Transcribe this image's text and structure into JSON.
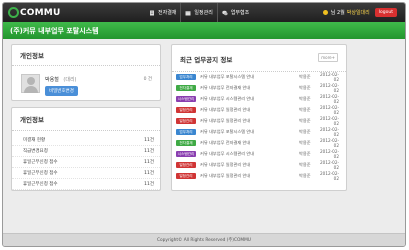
{
  "header": {
    "logo": "COMMU",
    "nav": [
      {
        "label": "전자결재",
        "icon": "document-icon"
      },
      {
        "label": "일정관리",
        "icon": "calendar-icon"
      },
      {
        "label": "업무협조",
        "icon": "chat-icon"
      }
    ],
    "user": {
      "prefix": "님 2월",
      "name": "박상일대리"
    },
    "logout_label": "logout"
  },
  "brand": {
    "title": "(주)커뮤 내부업무 포탈시스템"
  },
  "profile": {
    "title": "개인정보",
    "name": "박용철",
    "rank": "(대리)",
    "count": "0 건",
    "button": "비밀번호변경"
  },
  "personal_list": {
    "title": "개인정보",
    "rows": [
      {
        "label": "미결재 현황",
        "value": "11건"
      },
      {
        "label": "직급변경요청",
        "value": "11건"
      },
      {
        "label": "휴일근무신청 접수",
        "value": "11건"
      },
      {
        "label": "휴일근무신청 접수",
        "value": "11건"
      },
      {
        "label": "휴일근무신청 접수",
        "value": "11건"
      }
    ]
  },
  "notices": {
    "title": "최근 업무공지 정보",
    "more": "more+",
    "rows": [
      {
        "badge": "업무처리",
        "color": "#3a86d0",
        "title": "커뮤 내부업무 포탈시스템 안내",
        "author": "박용준",
        "date": "2012-02-02"
      },
      {
        "badge": "전자결재",
        "color": "#3faa45",
        "title": "커뮤 내부업무 전자결재 안내",
        "author": "박용준",
        "date": "2012-02-02"
      },
      {
        "badge": "시스템관리",
        "color": "#8a3fb0",
        "title": "커뮤 내부업무 시스템관리 안내",
        "author": "박용준",
        "date": "2012-02-02"
      },
      {
        "badge": "일정관리",
        "color": "#d03535",
        "title": "커뮤 내부업무 일정관리 안내",
        "author": "박용준",
        "date": "2012-02-02"
      },
      {
        "badge": "일정관리",
        "color": "#d03535",
        "title": "커뮤 내부업무 일정관리 안내",
        "author": "박용준",
        "date": "2012-02-02"
      },
      {
        "badge": "업무처리",
        "color": "#3a86d0",
        "title": "커뮤 내부업무 포탈시스템 안내",
        "author": "박용준",
        "date": "2012-02-02"
      },
      {
        "badge": "전자결재",
        "color": "#3faa45",
        "title": "커뮤 내부업무 전자결재 안내",
        "author": "박용준",
        "date": "2012-02-02"
      },
      {
        "badge": "시스템관리",
        "color": "#8a3fb0",
        "title": "커뮤 내부업무 시스템관리 안내",
        "author": "박용준",
        "date": "2012-02-02"
      },
      {
        "badge": "일정관리",
        "color": "#d03535",
        "title": "커뮤 내부업무 일정관리 안내",
        "author": "박용준",
        "date": "2012-02-02"
      },
      {
        "badge": "일정관리",
        "color": "#d03535",
        "title": "커뮤 내부업무 일정관리 안내",
        "author": "박용준",
        "date": "2012-02-02"
      }
    ]
  },
  "footer": {
    "text": "Copyright© All Rights Reserved (주)COMMU"
  }
}
